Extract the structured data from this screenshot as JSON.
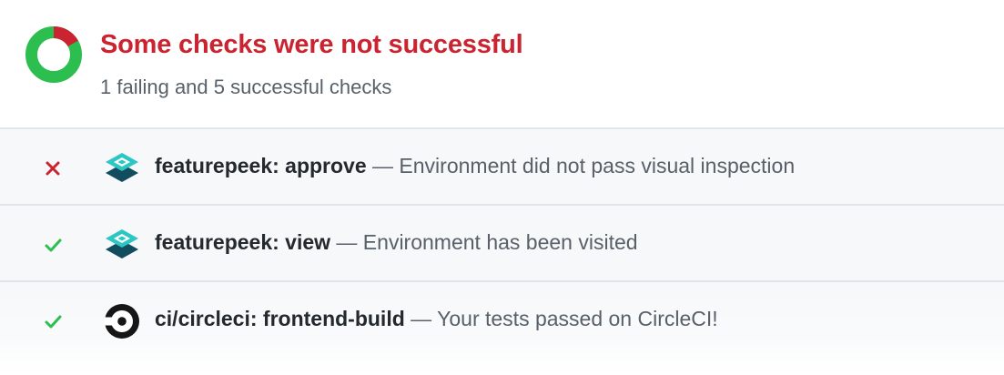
{
  "summary": {
    "title": "Some checks were not successful",
    "subtitle": "1 failing and 5 successful checks",
    "failing_count": 1,
    "successful_count": 5,
    "colors": {
      "failing": "#cb2431",
      "success": "#2cbe4e",
      "text_muted": "#586069",
      "text_strong": "#24292e"
    }
  },
  "checks": [
    {
      "status": "failure",
      "status_icon": "x-icon",
      "app_icon": "featurepeek-logo-icon",
      "name": "featurepeek: approve",
      "description": "— Environment did not pass visual inspection"
    },
    {
      "status": "success",
      "status_icon": "check-icon",
      "app_icon": "featurepeek-logo-icon",
      "name": "featurepeek: view",
      "description": "— Environment has been visited"
    },
    {
      "status": "success",
      "status_icon": "check-icon",
      "app_icon": "circleci-logo-icon",
      "name": "ci/circleci: frontend-build",
      "description": "— Your tests passed on CircleCI!"
    }
  ]
}
